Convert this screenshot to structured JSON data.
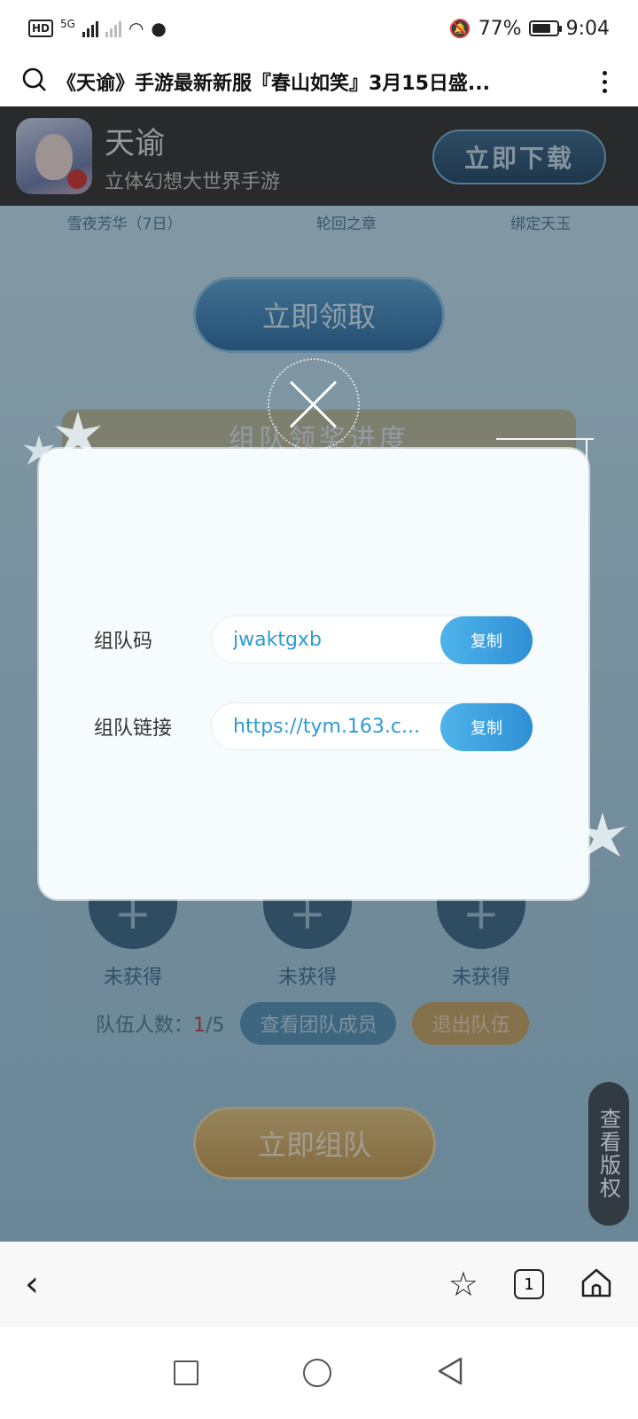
{
  "status_bar": {
    "hd_label": "HD",
    "network_label": "5G",
    "battery_percent": "77%",
    "battery_level": 0.77,
    "time": "9:04"
  },
  "url_bar": {
    "title": "《天谕》手游最新新服『春山如笑』3月15日盛..."
  },
  "web": {
    "banner": {
      "app_name": "天谕",
      "app_subtitle": "立体幻想大世界手游",
      "download_label": "立即下载"
    },
    "rewards": [
      "雪夜芳华（7日）",
      "轮回之章",
      "绑定天玉"
    ],
    "claim_label": "立即领取",
    "progress_title": "组队领奖进度",
    "slots": [
      "未获得",
      "未获得",
      "未获得"
    ],
    "team_count_label": "队伍人数：",
    "team_count_current": "1",
    "team_count_total": "/5",
    "view_members_label": "查看团队成员",
    "leave_team_label": "退出队伍",
    "team_now_label": "立即组队",
    "copyright_label": "查看版权"
  },
  "modal": {
    "code_label": "组队码",
    "code_value": "jwaktgxb",
    "link_label": "组队链接",
    "link_value": "https://tym.163.c...",
    "copy_label": "复制"
  },
  "toolbar": {
    "tabs_count": "1"
  },
  "colors": {
    "accent_blue": "#2f9bd2",
    "copy_button": "#3fa3e0",
    "gold": "#caa563"
  }
}
